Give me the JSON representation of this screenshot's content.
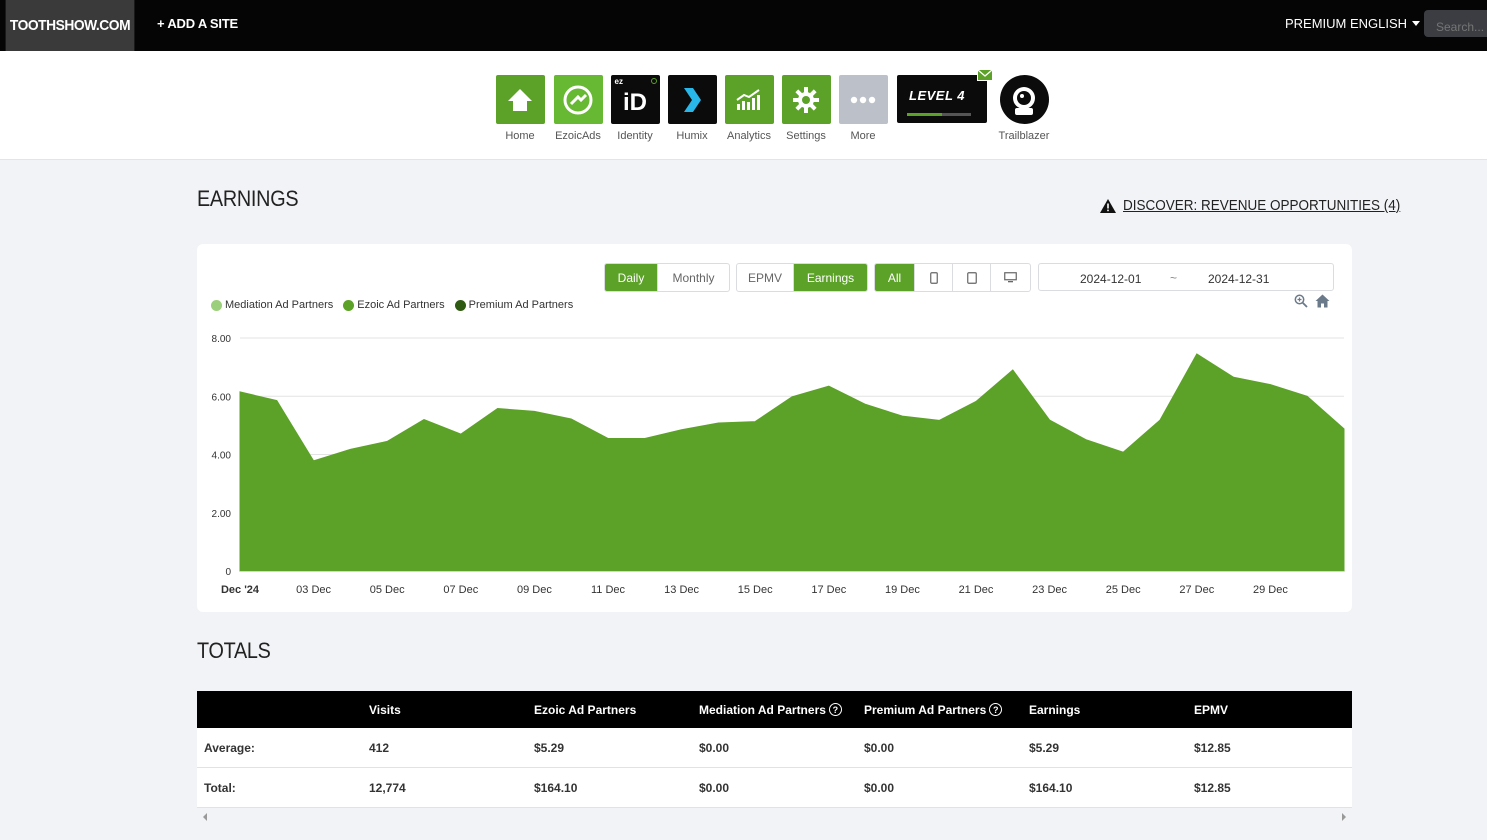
{
  "topbar": {
    "site_name": "TOOTHSHOW.COM",
    "add_site": "+ ADD A SITE",
    "premium": "PREMIUM",
    "language": "ENGLISH",
    "search_placeholder": "Search..."
  },
  "nav": {
    "items": [
      {
        "label": "Home",
        "icon": "home-icon"
      },
      {
        "label": "EzoicAds",
        "icon": "ezoicads-icon"
      },
      {
        "label": "Identity",
        "icon": "identity-icon"
      },
      {
        "label": "Humix",
        "icon": "humix-icon"
      },
      {
        "label": "Analytics",
        "icon": "analytics-icon"
      },
      {
        "label": "Settings",
        "icon": "gear-icon"
      },
      {
        "label": "More",
        "icon": "more-icon"
      }
    ],
    "identity_badge": "ez",
    "identity_text": "iD",
    "level_text": "LEVEL 4",
    "level_progress": 0.55,
    "trailblazer": "Trailblazer"
  },
  "earnings": {
    "title": "EARNINGS",
    "discover": "DISCOVER: REVENUE OPPORTUNITIES (4)",
    "period_buttons": [
      "Daily",
      "Monthly"
    ],
    "metric_buttons": [
      "EPMV",
      "Earnings"
    ],
    "device_all": "All",
    "date_start": "2024-12-01",
    "date_sep": "~",
    "date_end": "2024-12-31"
  },
  "chart_data": {
    "type": "area",
    "legend": [
      {
        "name": "Mediation Ad Partners",
        "color": "#9ccf7c"
      },
      {
        "name": "Ezoic Ad Partners",
        "color": "#5ca128"
      },
      {
        "name": "Premium Ad Partners",
        "color": "#2f5a12"
      }
    ],
    "x_ticks": [
      "Dec '24",
      "03 Dec",
      "05 Dec",
      "07 Dec",
      "09 Dec",
      "11 Dec",
      "13 Dec",
      "15 Dec",
      "17 Dec",
      "19 Dec",
      "21 Dec",
      "23 Dec",
      "25 Dec",
      "27 Dec",
      "29 Dec"
    ],
    "y_ticks": [
      "0",
      "2.00",
      "4.00",
      "6.00",
      "8.00"
    ],
    "ylim": [
      0,
      8
    ],
    "x": [
      "2024-12-01",
      "2024-12-02",
      "2024-12-03",
      "2024-12-04",
      "2024-12-05",
      "2024-12-06",
      "2024-12-07",
      "2024-12-08",
      "2024-12-09",
      "2024-12-10",
      "2024-12-11",
      "2024-12-12",
      "2024-12-13",
      "2024-12-14",
      "2024-12-15",
      "2024-12-16",
      "2024-12-17",
      "2024-12-18",
      "2024-12-19",
      "2024-12-20",
      "2024-12-21",
      "2024-12-22",
      "2024-12-23",
      "2024-12-24",
      "2024-12-25",
      "2024-12-26",
      "2024-12-27",
      "2024-12-28",
      "2024-12-29",
      "2024-12-30",
      "2024-12-31"
    ],
    "series": [
      {
        "name": "Ezoic Ad Partners",
        "color": "#5ca128",
        "values": [
          6.15,
          5.85,
          3.78,
          4.18,
          4.45,
          5.2,
          4.7,
          5.58,
          5.48,
          5.22,
          4.55,
          4.55,
          4.85,
          5.08,
          5.13,
          5.98,
          6.35,
          5.72,
          5.32,
          5.17,
          5.82,
          6.9,
          5.18,
          4.5,
          4.08,
          5.18,
          7.45,
          6.65,
          6.4,
          6.0,
          4.88
        ]
      }
    ]
  },
  "totals": {
    "title": "TOTALS",
    "headers": [
      "",
      "Visits",
      "Ezoic Ad Partners",
      "Mediation Ad Partners",
      "Premium Ad Partners",
      "Earnings",
      "EPMV"
    ],
    "rows": [
      [
        "Average:",
        "412",
        "$5.29",
        "$0.00",
        "$0.00",
        "$5.29",
        "$12.85"
      ],
      [
        "Total:",
        "12,774",
        "$164.10",
        "$0.00",
        "$0.00",
        "$164.10",
        "$12.85"
      ]
    ]
  }
}
